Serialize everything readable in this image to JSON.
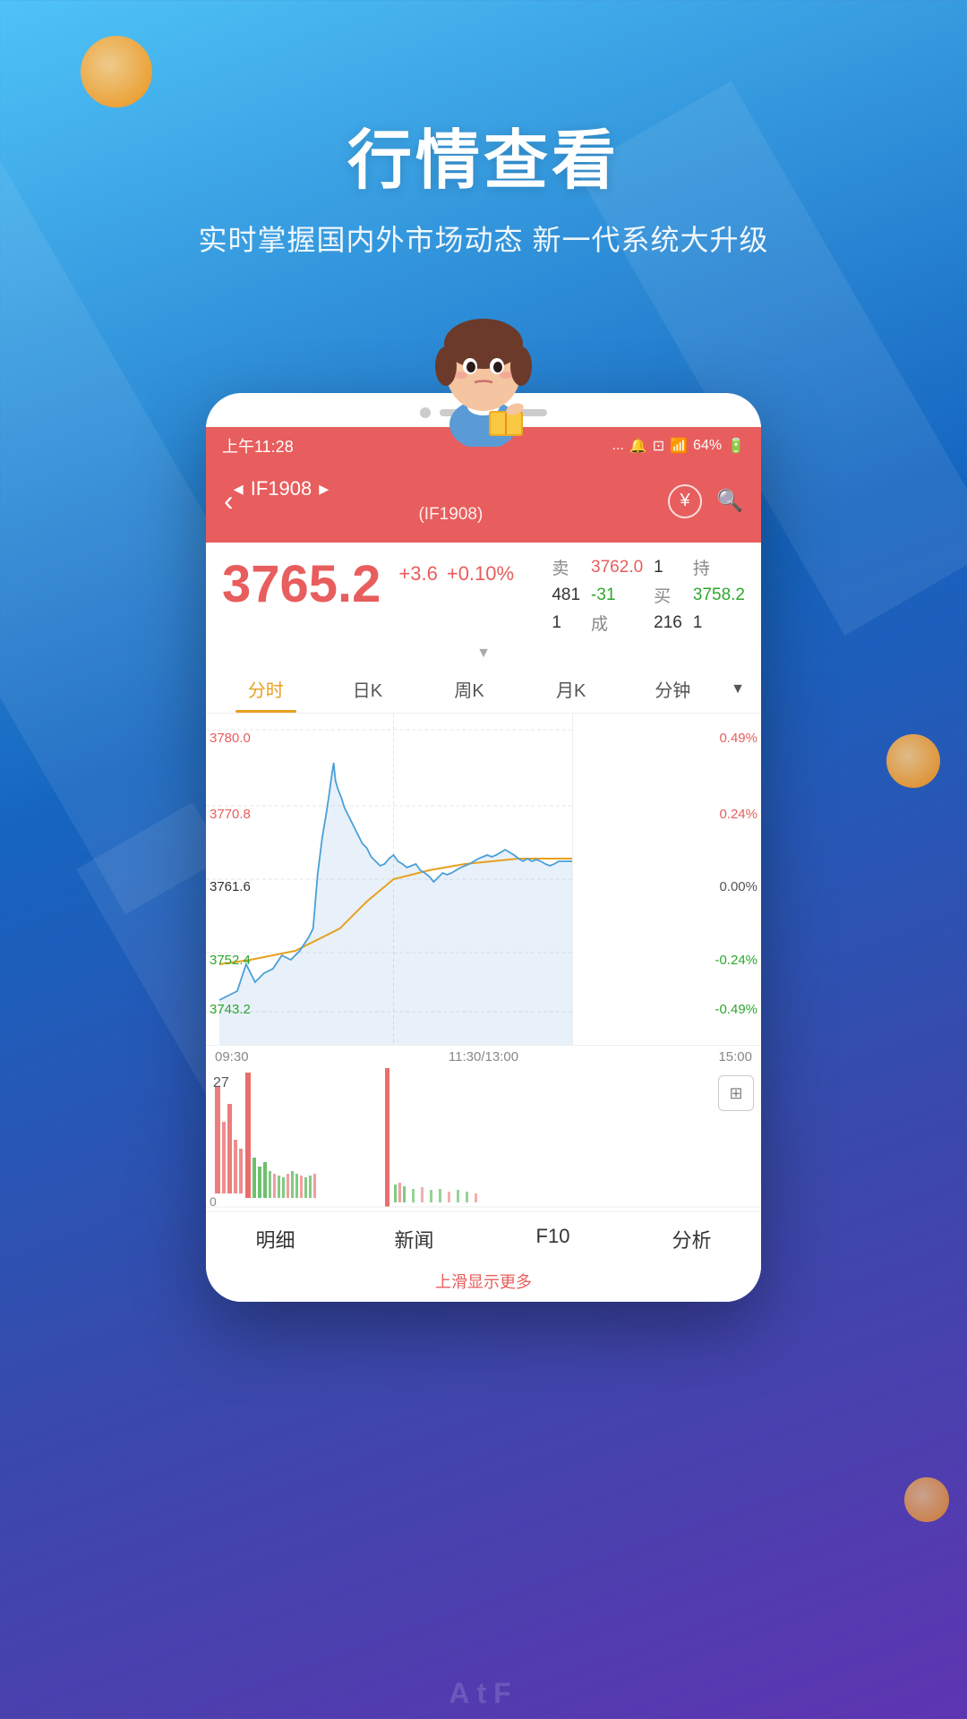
{
  "background": {
    "gradient_start": "#4fc3f7",
    "gradient_end": "#5e35b1"
  },
  "hero": {
    "title": "行情查看",
    "subtitle": "实时掌握国内外市场动态 新一代系统大升级"
  },
  "status_bar": {
    "time": "上午11:28",
    "signal": "...",
    "battery": "64%"
  },
  "nav": {
    "back_label": "‹",
    "symbol_left_arrow": "◂",
    "symbol": "IF1908",
    "symbol_sub": "(IF1908)",
    "symbol_right_arrow": "▸",
    "icon_yuan": "¥",
    "icon_search": "🔍"
  },
  "price": {
    "main": "3765.2",
    "change_abs": "+3.6",
    "change_pct": "+0.10%",
    "sell_label": "卖",
    "sell_price": "3762.0",
    "sell_qty": "1",
    "hold_label": "持",
    "hold_val": "481",
    "hold_change": "-31",
    "buy_label": "买",
    "buy_price": "3758.2",
    "buy_qty": "1",
    "deal_label": "成",
    "deal_val": "216",
    "deal_qty": "1"
  },
  "chart_tabs": [
    {
      "label": "分时",
      "active": true
    },
    {
      "label": "日K",
      "active": false
    },
    {
      "label": "周K",
      "active": false
    },
    {
      "label": "月K",
      "active": false
    },
    {
      "label": "分钟",
      "active": false
    }
  ],
  "chart": {
    "y_labels_left": [
      {
        "value": "3780.0",
        "color": "red",
        "top_pct": 5
      },
      {
        "value": "3770.8",
        "color": "red",
        "top_pct": 28
      },
      {
        "value": "3761.6",
        "color": "black",
        "top_pct": 52
      },
      {
        "value": "3752.4",
        "color": "green",
        "top_pct": 75
      },
      {
        "value": "3743.2",
        "color": "green",
        "top_pct": 90
      }
    ],
    "y_labels_right": [
      {
        "value": "0.49%",
        "color": "red",
        "top_pct": 5
      },
      {
        "value": "0.24%",
        "color": "red",
        "top_pct": 28
      },
      {
        "value": "0.00%",
        "color": "gray",
        "top_pct": 52
      },
      {
        "value": "-0.24%",
        "color": "green",
        "top_pct": 75
      },
      {
        "value": "-0.49%",
        "color": "green",
        "top_pct": 90
      }
    ],
    "x_labels": [
      "09:30",
      "11:30/13:00",
      "15:00"
    ],
    "vol_label": "27",
    "vol_label_bottom": "0"
  },
  "bottom_tabs": [
    {
      "label": "明细"
    },
    {
      "label": "新闻"
    },
    {
      "label": "F10"
    },
    {
      "label": "分析"
    }
  ],
  "bottom_hint": "上滑显示更多",
  "atf": "AtF"
}
